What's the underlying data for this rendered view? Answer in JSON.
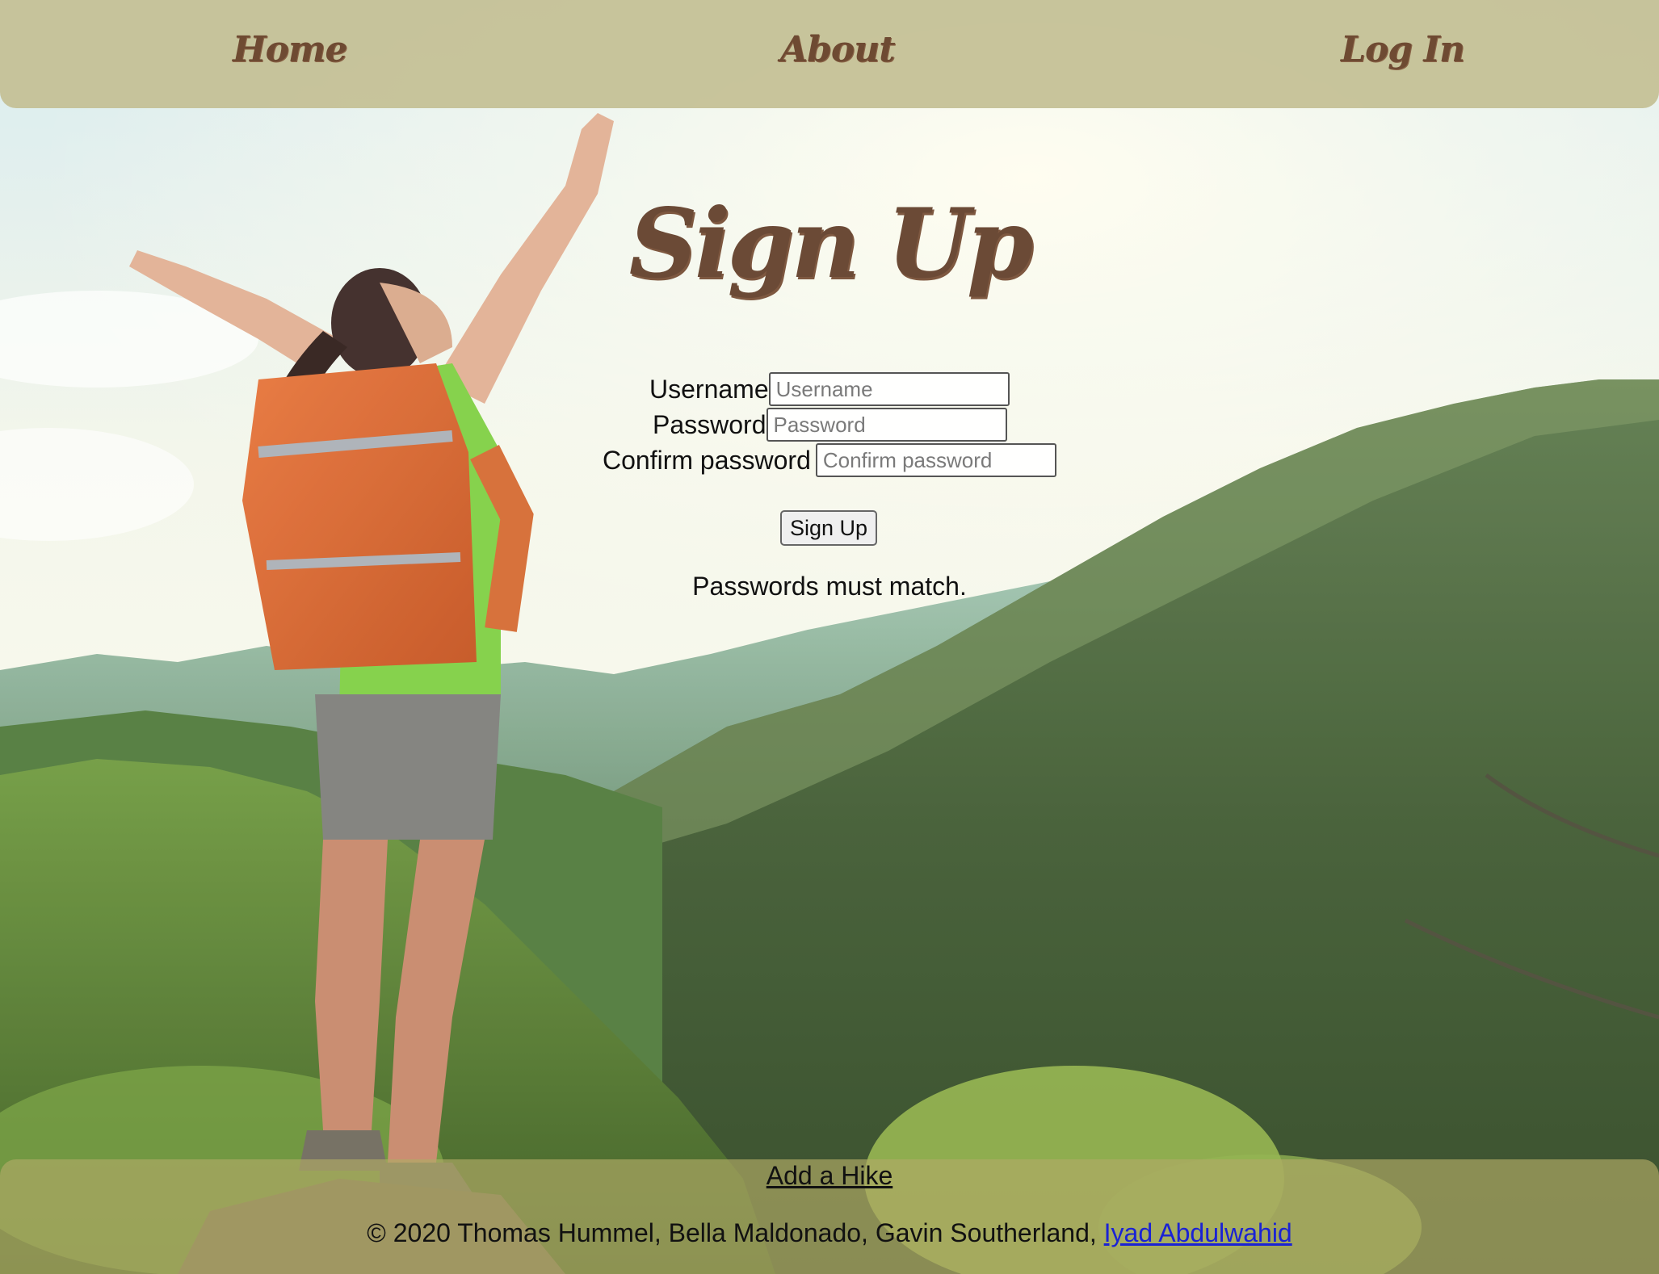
{
  "nav": {
    "home_label": "Home",
    "about_label": "About",
    "login_label": "Log In"
  },
  "signup": {
    "title": "Sign Up",
    "username_label": "Username",
    "username_placeholder": "Username",
    "password_label": "Password",
    "password_placeholder": "Password",
    "confirm_label": "Confirm password",
    "confirm_placeholder": "Confirm password",
    "button_label": "Sign Up",
    "validation_message": "Passwords must match."
  },
  "footer": {
    "add_hike_label": "Add a Hike",
    "copyright_text": "© 2020 Thomas Hummel, Bella Maldonado, Gavin Southerland, ",
    "author_link_label": "Iyad Abdulwahid"
  },
  "colors": {
    "nav_background": "#c4c094",
    "brand_brown": "#6b4a36",
    "link_blue": "#1a22d4"
  }
}
